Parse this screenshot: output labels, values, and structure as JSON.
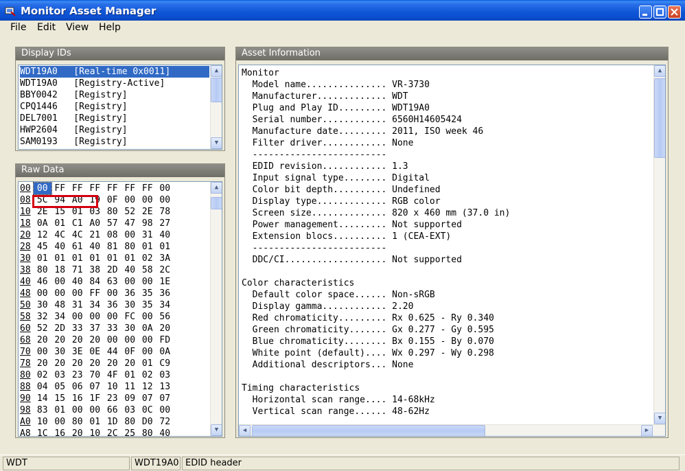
{
  "window": {
    "title": "Monitor Asset Manager"
  },
  "menu": [
    "File",
    "Edit",
    "View",
    "Help"
  ],
  "display_ids": {
    "header": "Display IDs",
    "items": [
      {
        "id": "WDT19A0",
        "source": "[Real-time 0x0011]",
        "selected": true
      },
      {
        "id": "WDT19A0",
        "source": "[Registry-Active]",
        "selected": false
      },
      {
        "id": "BBY0042",
        "source": "[Registry]",
        "selected": false
      },
      {
        "id": "CPQ1446",
        "source": "[Registry]",
        "selected": false
      },
      {
        "id": "DEL7001",
        "source": "[Registry]",
        "selected": false
      },
      {
        "id": "HWP2604",
        "source": "[Registry]",
        "selected": false
      },
      {
        "id": "SAM0193",
        "source": "[Registry]",
        "selected": false
      }
    ]
  },
  "raw_data": {
    "header": "Raw Data",
    "rows": [
      {
        "addr": "00",
        "bytes": [
          "00",
          "FF",
          "FF",
          "FF",
          "FF",
          "FF",
          "FF",
          "00"
        ]
      },
      {
        "addr": "08",
        "bytes": [
          "5C",
          "94",
          "A0",
          "19",
          "0F",
          "00",
          "00",
          "00"
        ]
      },
      {
        "addr": "10",
        "bytes": [
          "2E",
          "15",
          "01",
          "03",
          "80",
          "52",
          "2E",
          "78"
        ]
      },
      {
        "addr": "18",
        "bytes": [
          "0A",
          "01",
          "C1",
          "A0",
          "57",
          "47",
          "98",
          "27"
        ]
      },
      {
        "addr": "20",
        "bytes": [
          "12",
          "4C",
          "4C",
          "21",
          "08",
          "00",
          "31",
          "40"
        ]
      },
      {
        "addr": "28",
        "bytes": [
          "45",
          "40",
          "61",
          "40",
          "81",
          "80",
          "01",
          "01"
        ]
      },
      {
        "addr": "30",
        "bytes": [
          "01",
          "01",
          "01",
          "01",
          "01",
          "01",
          "02",
          "3A"
        ]
      },
      {
        "addr": "38",
        "bytes": [
          "80",
          "18",
          "71",
          "38",
          "2D",
          "40",
          "58",
          "2C"
        ]
      },
      {
        "addr": "40",
        "bytes": [
          "46",
          "00",
          "40",
          "84",
          "63",
          "00",
          "00",
          "1E"
        ]
      },
      {
        "addr": "48",
        "bytes": [
          "00",
          "00",
          "00",
          "FF",
          "00",
          "36",
          "35",
          "36"
        ]
      },
      {
        "addr": "50",
        "bytes": [
          "30",
          "48",
          "31",
          "34",
          "36",
          "30",
          "35",
          "34"
        ]
      },
      {
        "addr": "58",
        "bytes": [
          "32",
          "34",
          "00",
          "00",
          "00",
          "FC",
          "00",
          "56"
        ]
      },
      {
        "addr": "60",
        "bytes": [
          "52",
          "2D",
          "33",
          "37",
          "33",
          "30",
          "0A",
          "20"
        ]
      },
      {
        "addr": "68",
        "bytes": [
          "20",
          "20",
          "20",
          "20",
          "00",
          "00",
          "00",
          "FD"
        ]
      },
      {
        "addr": "70",
        "bytes": [
          "00",
          "30",
          "3E",
          "0E",
          "44",
          "0F",
          "00",
          "0A"
        ]
      },
      {
        "addr": "78",
        "bytes": [
          "20",
          "20",
          "20",
          "20",
          "20",
          "20",
          "01",
          "C9"
        ]
      },
      {
        "addr": "80",
        "bytes": [
          "02",
          "03",
          "23",
          "70",
          "4F",
          "01",
          "02",
          "03"
        ]
      },
      {
        "addr": "88",
        "bytes": [
          "04",
          "05",
          "06",
          "07",
          "10",
          "11",
          "12",
          "13"
        ]
      },
      {
        "addr": "90",
        "bytes": [
          "14",
          "15",
          "16",
          "1F",
          "23",
          "09",
          "07",
          "07"
        ]
      },
      {
        "addr": "98",
        "bytes": [
          "83",
          "01",
          "00",
          "00",
          "66",
          "03",
          "0C",
          "00"
        ]
      },
      {
        "addr": "A0",
        "bytes": [
          "10",
          "00",
          "80",
          "01",
          "1D",
          "80",
          "D0",
          "72"
        ]
      },
      {
        "addr": "A8",
        "bytes": [
          "1C",
          "16",
          "20",
          "10",
          "2C",
          "25",
          "80",
          "40"
        ]
      }
    ]
  },
  "asset_info": {
    "header": "Asset Information",
    "lines": [
      "Monitor",
      "  Model name............... VR-3730",
      "  Manufacturer............. WDT",
      "  Plug and Play ID......... WDT19A0",
      "  Serial number............ 6560H14605424",
      "  Manufacture date......... 2011, ISO week 46",
      "  Filter driver............ None",
      "  -------------------------",
      "  EDID revision............ 1.3",
      "  Input signal type........ Digital",
      "  Color bit depth.......... Undefined",
      "  Display type............. RGB color",
      "  Screen size.............. 820 x 460 mm (37.0 in)",
      "  Power management......... Not supported",
      "  Extension blocs.......... 1 (CEA-EXT)",
      "  -------------------------",
      "  DDC/CI................... Not supported",
      "",
      "Color characteristics",
      "  Default color space...... Non-sRGB",
      "  Display gamma............ 2.20",
      "  Red chromaticity......... Rx 0.625 - Ry 0.340",
      "  Green chromaticity....... Gx 0.277 - Gy 0.595",
      "  Blue chromaticity........ Bx 0.155 - By 0.070",
      "  White point (default).... Wx 0.297 - Wy 0.298",
      "  Additional descriptors... None",
      "",
      "Timing characteristics",
      "  Horizontal scan range.... 14-68kHz",
      "  Vertical scan range...... 48-62Hz"
    ]
  },
  "status": {
    "left": "WDT",
    "middle": "WDT19A0",
    "right": "EDID header"
  },
  "colors": {
    "titlebar": "#0b4fd0",
    "selection": "#316ac5",
    "highlight_box": "#d4000f"
  }
}
